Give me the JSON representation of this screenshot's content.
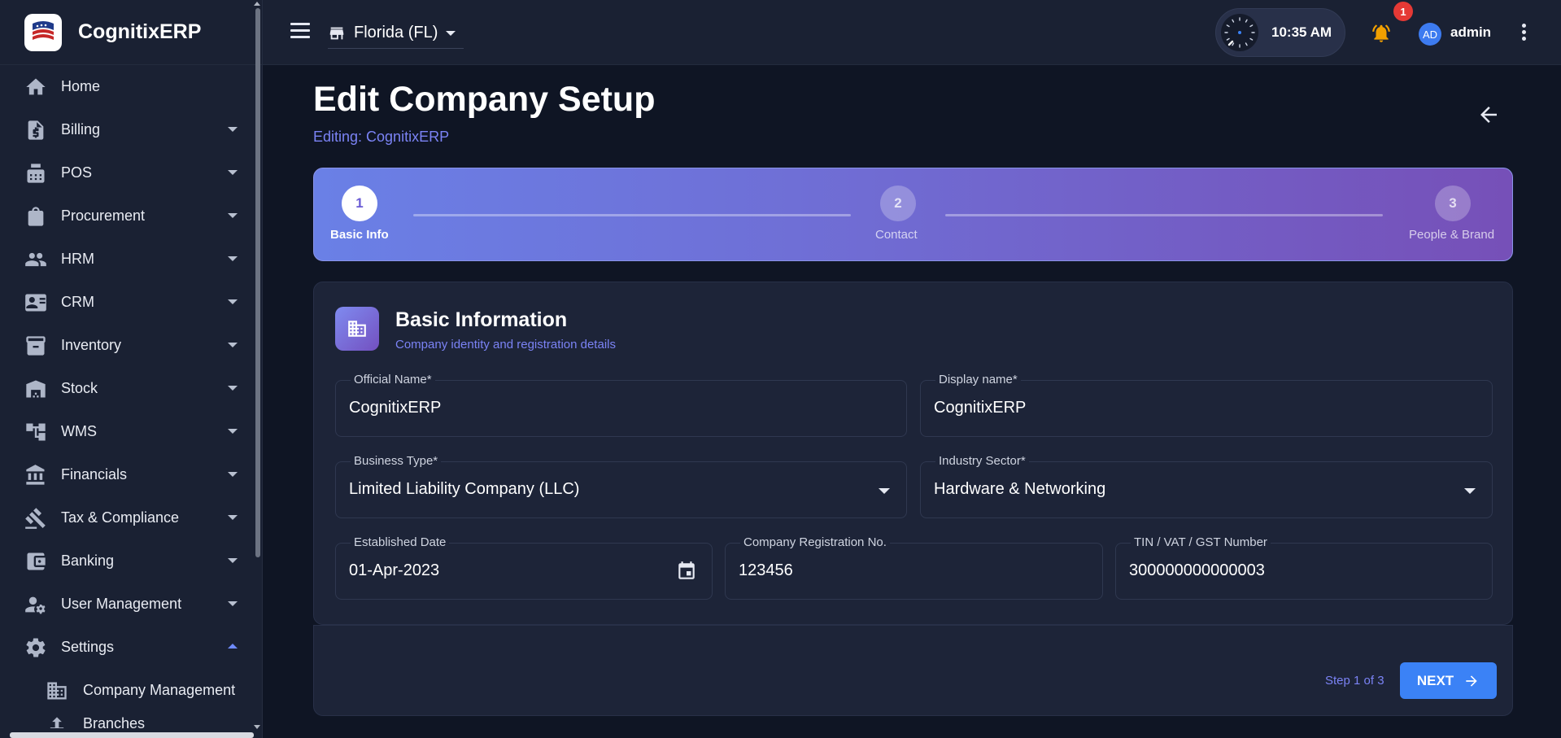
{
  "sidebar": {
    "brand": "CognitixERP",
    "items": [
      {
        "label": "Home",
        "icon": "home-icon",
        "expandable": false
      },
      {
        "label": "Billing",
        "icon": "receipt-icon",
        "expandable": true
      },
      {
        "label": "POS",
        "icon": "cash-register-icon",
        "expandable": true
      },
      {
        "label": "Procurement",
        "icon": "shopping-bag-icon",
        "expandable": true
      },
      {
        "label": "HRM",
        "icon": "people-icon",
        "expandable": true
      },
      {
        "label": "CRM",
        "icon": "contact-card-icon",
        "expandable": true
      },
      {
        "label": "Inventory",
        "icon": "archive-box-icon",
        "expandable": true
      },
      {
        "label": "Stock",
        "icon": "warehouse-icon",
        "expandable": true
      },
      {
        "label": "WMS",
        "icon": "hierarchy-icon",
        "expandable": true
      },
      {
        "label": "Financials",
        "icon": "bank-icon",
        "expandable": true
      },
      {
        "label": "Tax & Compliance",
        "icon": "gavel-icon",
        "expandable": true
      },
      {
        "label": "Banking",
        "icon": "wallet-icon",
        "expandable": true
      },
      {
        "label": "User Management",
        "icon": "user-gear-icon",
        "expandable": true
      },
      {
        "label": "Settings",
        "icon": "gear-icon",
        "expandable": true,
        "expanded": true
      }
    ],
    "subitems": [
      {
        "label": "Company Management",
        "icon": "building-icon"
      },
      {
        "label": "Branches",
        "icon": "branch-icon"
      }
    ]
  },
  "topbar": {
    "store": "Florida (FL)",
    "time": "10:35 AM",
    "notification_count": "1",
    "avatar_initials": "AD",
    "username": "admin"
  },
  "page": {
    "title": "Edit Company Setup",
    "subtitle": "Editing: CognitixERP"
  },
  "stepper": {
    "steps": [
      {
        "number": "1",
        "label": "Basic Info",
        "active": true
      },
      {
        "number": "2",
        "label": "Contact",
        "active": false
      },
      {
        "number": "3",
        "label": "People & Brand",
        "active": false
      }
    ]
  },
  "section": {
    "title": "Basic Information",
    "subtitle": "Company identity and registration details"
  },
  "form": {
    "official_name": {
      "label": "Official Name*",
      "value": "CognitixERP"
    },
    "display_name": {
      "label": "Display name*",
      "value": "CognitixERP"
    },
    "business_type": {
      "label": "Business Type*",
      "value": "Limited Liability Company (LLC)"
    },
    "industry_sector": {
      "label": "Industry Sector*",
      "value": "Hardware & Networking"
    },
    "established_date": {
      "label": "Established Date",
      "value": "01-Apr-2023"
    },
    "registration_no": {
      "label": "Company Registration No.",
      "value": "123456"
    },
    "tin": {
      "label": "TIN / VAT / GST Number",
      "value": "300000000000003"
    }
  },
  "footer": {
    "step_count": "Step 1 of 3",
    "next_label": "NEXT"
  },
  "colors": {
    "accent": "#3b82f6",
    "subtitle": "#7b83f5",
    "badge": "#e53935",
    "bell": "#f2a000"
  }
}
